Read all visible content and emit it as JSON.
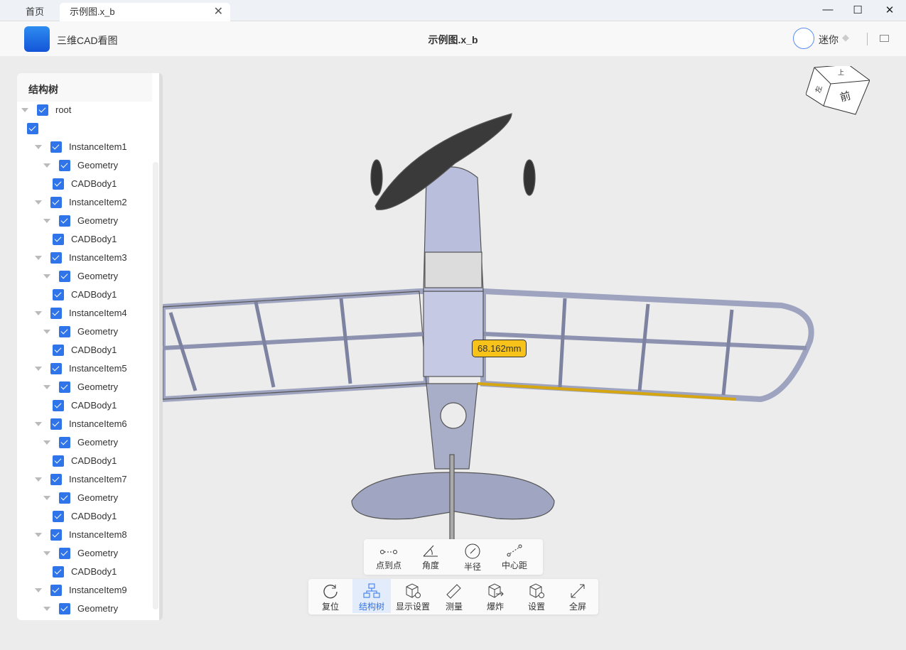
{
  "tabs": {
    "home": "首页",
    "doc": "示例图.x_b"
  },
  "header": {
    "app_name": "三维CAD看图",
    "doc_title": "示例图.x_b",
    "user": "迷你"
  },
  "sidebar": {
    "title": "结构树",
    "root": "root",
    "items": [
      "InstanceItem1",
      "InstanceItem2",
      "InstanceItem3",
      "InstanceItem4",
      "InstanceItem5",
      "InstanceItem6",
      "InstanceItem7",
      "InstanceItem8",
      "InstanceItem9"
    ],
    "geometry": "Geometry",
    "body": "CADBody1"
  },
  "measure_tools": [
    "点到点",
    "角度",
    "半径",
    "中心距"
  ],
  "toolbar": [
    "复位",
    "结构树",
    "显示设置",
    "测量",
    "爆炸",
    "设置",
    "全屏"
  ],
  "dimension": "68.162mm",
  "view_cube": {
    "top": "上",
    "left": "左",
    "front": "前"
  },
  "colors": {
    "accent": "#2f74e8",
    "dimension": "#f7c21a"
  }
}
